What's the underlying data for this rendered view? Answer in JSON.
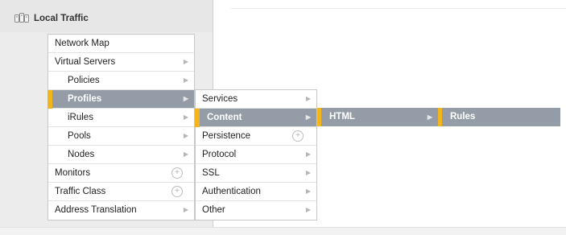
{
  "nav": {
    "section_title": "Local Traffic",
    "items": [
      {
        "label": "Network Map",
        "has_arrow": false,
        "has_plus": false
      },
      {
        "label": "Virtual Servers",
        "has_arrow": true,
        "has_plus": false
      },
      {
        "label": "Policies",
        "has_arrow": true,
        "has_plus": false
      },
      {
        "label": "Profiles",
        "has_arrow": true,
        "has_plus": false
      },
      {
        "label": "iRules",
        "has_arrow": true,
        "has_plus": false
      },
      {
        "label": "Pools",
        "has_arrow": true,
        "has_plus": false
      },
      {
        "label": "Nodes",
        "has_arrow": true,
        "has_plus": false
      },
      {
        "label": "Monitors",
        "has_arrow": false,
        "has_plus": true
      },
      {
        "label": "Traffic Class",
        "has_arrow": false,
        "has_plus": true
      },
      {
        "label": "Address Translation",
        "has_arrow": true,
        "has_plus": false
      }
    ]
  },
  "submenu_profiles": {
    "items": [
      {
        "label": "Services",
        "has_arrow": true,
        "has_plus": false
      },
      {
        "label": "Content",
        "has_arrow": true,
        "has_plus": false
      },
      {
        "label": "Persistence",
        "has_arrow": false,
        "has_plus": true
      },
      {
        "label": "Protocol",
        "has_arrow": true,
        "has_plus": false
      },
      {
        "label": "SSL",
        "has_arrow": true,
        "has_plus": false
      },
      {
        "label": "Authentication",
        "has_arrow": true,
        "has_plus": false
      },
      {
        "label": "Other",
        "has_arrow": true,
        "has_plus": false
      }
    ]
  },
  "submenu_content": {
    "label": "HTML"
  },
  "submenu_html": {
    "label": "Rules"
  },
  "icons": {
    "arrow": "chevron-right-icon",
    "plus": "plus-circle-icon",
    "section": "local-traffic-icon"
  },
  "colors": {
    "active_bg": "#949ca7",
    "accent": "#f2b51d",
    "menu_bg": "#ffffff",
    "nav_bg": "#e7e7e7"
  }
}
